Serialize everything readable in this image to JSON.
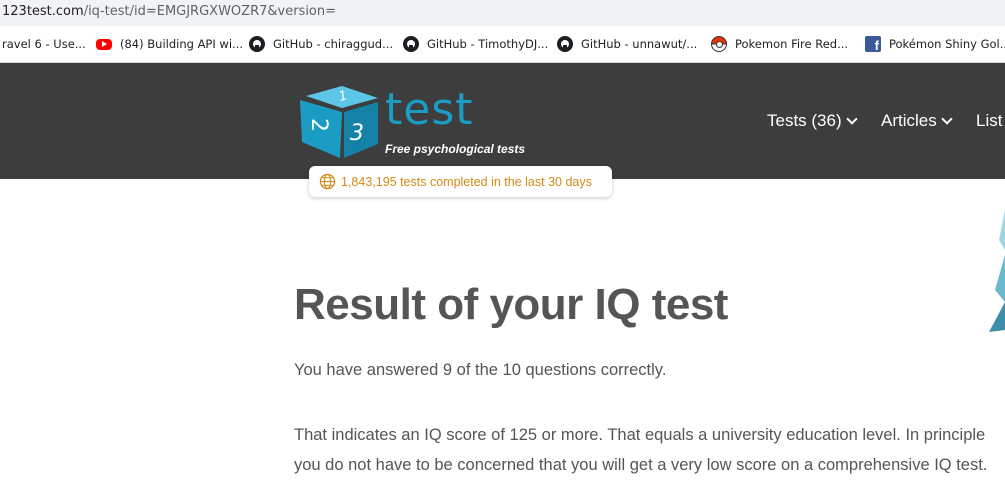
{
  "browser": {
    "url_host": "123test.com",
    "url_path": "/iq-test/id=EMGJRGXWOZR7&version="
  },
  "bookmarks": [
    {
      "label": "ravel 6 - Use...",
      "icon": "none"
    },
    {
      "label": "(84) Building API wi...",
      "icon": "youtube-icon"
    },
    {
      "label": "GitHub - chiraggud...",
      "icon": "github-icon"
    },
    {
      "label": "GitHub - TimothyDJ...",
      "icon": "github-icon"
    },
    {
      "label": "GitHub - unnawut/...",
      "icon": "github-icon"
    },
    {
      "label": "Pokemon Fire Red...",
      "icon": "pokeball-icon"
    },
    {
      "label": "Pokémon Shiny Gol...",
      "icon": "facebook-icon"
    }
  ],
  "site": {
    "logo_word": "test",
    "tagline": "Free psychological tests",
    "brand_color": "#1a9cc4",
    "header_color": "#3d3d3d",
    "nav": [
      {
        "label": "Tests (36)",
        "has_dropdown": true
      },
      {
        "label": "Articles",
        "has_dropdown": true
      },
      {
        "label": "List",
        "has_dropdown": false
      }
    ],
    "counter_text": "1,843,195 tests completed in the last 30 days",
    "counter_color": "#d48a18"
  },
  "main": {
    "title": "Result of your IQ test",
    "para1": "You have answered 9 of the 10 questions correctly.",
    "para2": "That indicates an IQ score of 125 or more. That equals a university education level. In principle you do not have to be concerned that you will get a very low score on a comprehensive IQ test."
  }
}
